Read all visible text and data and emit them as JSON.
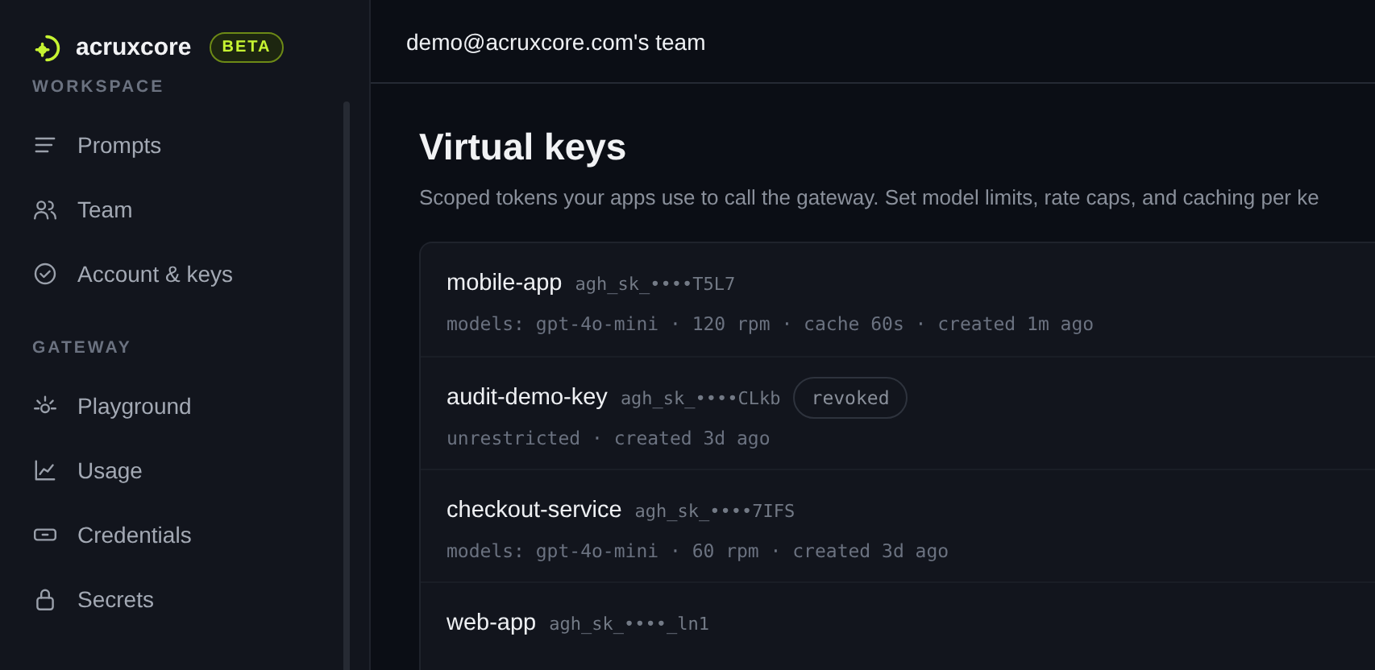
{
  "brand": {
    "name": "acruxcore",
    "badge": "BETA"
  },
  "sidebar": {
    "sections": [
      {
        "title": "WORKSPACE",
        "items": [
          {
            "label": "Prompts"
          },
          {
            "label": "Team"
          },
          {
            "label": "Account & keys"
          }
        ]
      },
      {
        "title": "GATEWAY",
        "items": [
          {
            "label": "Playground"
          },
          {
            "label": "Usage"
          },
          {
            "label": "Credentials"
          },
          {
            "label": "Secrets"
          }
        ]
      }
    ]
  },
  "header": {
    "team": "demo@acruxcore.com's team"
  },
  "page": {
    "title": "Virtual keys",
    "subtitle": "Scoped tokens your apps use to call the gateway. Set model limits, rate caps, and caching per ke"
  },
  "keys": [
    {
      "name": "mobile-app",
      "token": "agh_sk_••••T5L7",
      "meta": "models: gpt-4o-mini · 120 rpm · cache 60s · created 1m ago"
    },
    {
      "name": "audit-demo-key",
      "token": "agh_sk_••••CLkb",
      "badge": "revoked",
      "meta": "unrestricted · created 3d ago"
    },
    {
      "name": "checkout-service",
      "token": "agh_sk_••••7IFS",
      "meta": "models: gpt-4o-mini · 60 rpm · created 3d ago"
    },
    {
      "name": "web-app",
      "token": "agh_sk_••••_ln1"
    }
  ]
}
